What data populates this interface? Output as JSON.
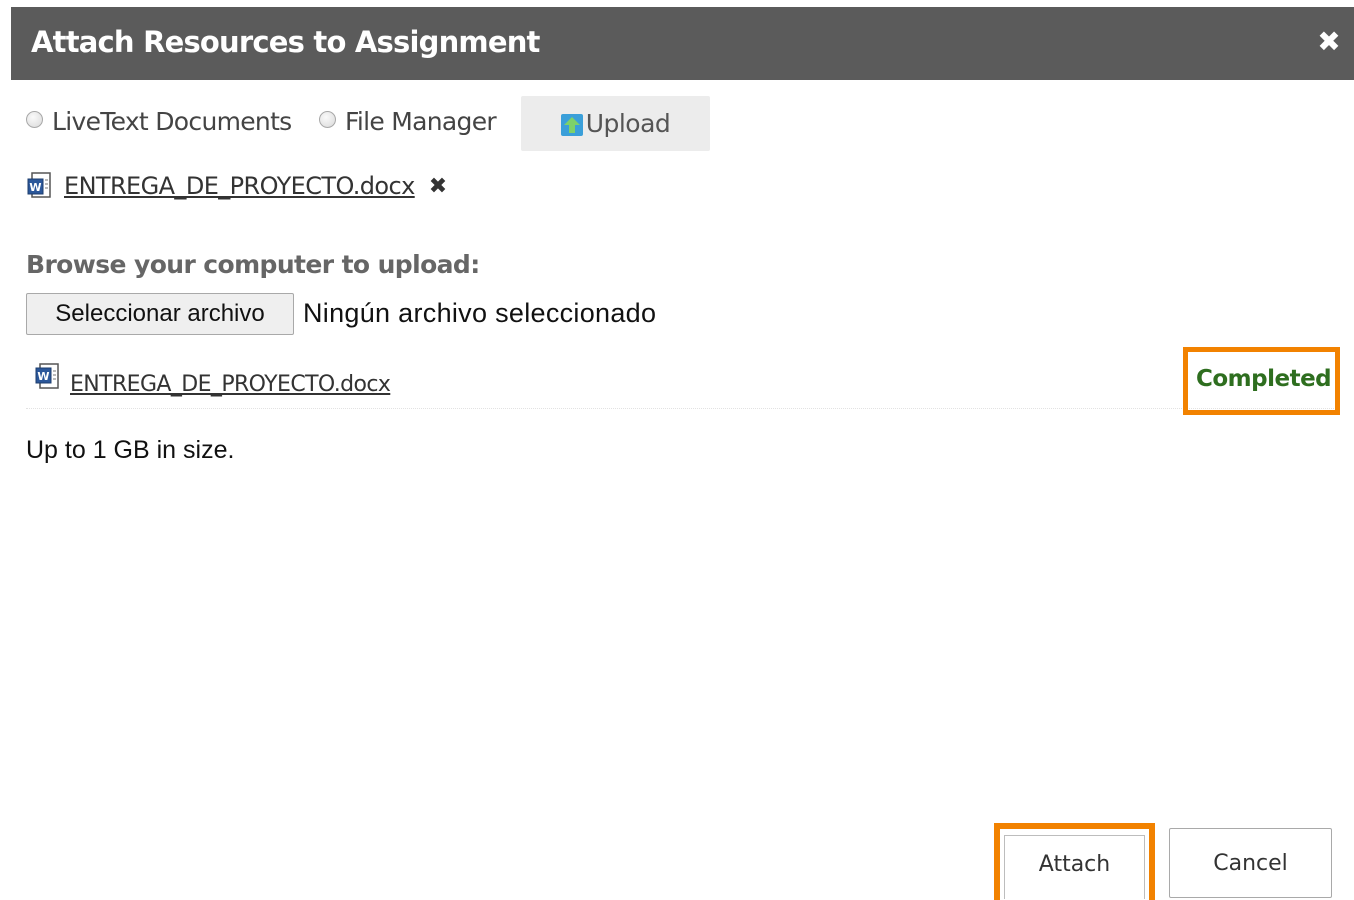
{
  "dialog": {
    "title": "Attach Resources to Assignment",
    "close_glyph": "✖"
  },
  "sources": {
    "options": [
      {
        "label": "LiveText Documents",
        "selected": false
      },
      {
        "label": "File Manager",
        "selected": false
      }
    ],
    "upload_label": "Upload",
    "upload_icon": "upload-arrow-icon"
  },
  "attached": {
    "file_name": "ENTREGA_DE_PROYECTO.docx",
    "file_icon": "word-document-icon",
    "remove_glyph": "✖"
  },
  "browse": {
    "label": "Browse your computer to upload:",
    "choose_button": "Seleccionar archivo",
    "no_file_text": "Ningún archivo seleccionado"
  },
  "upload_list": [
    {
      "file_name": "ENTREGA_DE_PROYECTO.docx",
      "status": "Completed",
      "status_color": "#2e6e1f"
    }
  ],
  "size_note": "Up to 1 GB in size.",
  "footer": {
    "attach_label": "Attach",
    "cancel_label": "Cancel"
  },
  "colors": {
    "titlebar": "#5b5b5b",
    "highlight": "#f28200",
    "completed": "#2e6e1f"
  }
}
